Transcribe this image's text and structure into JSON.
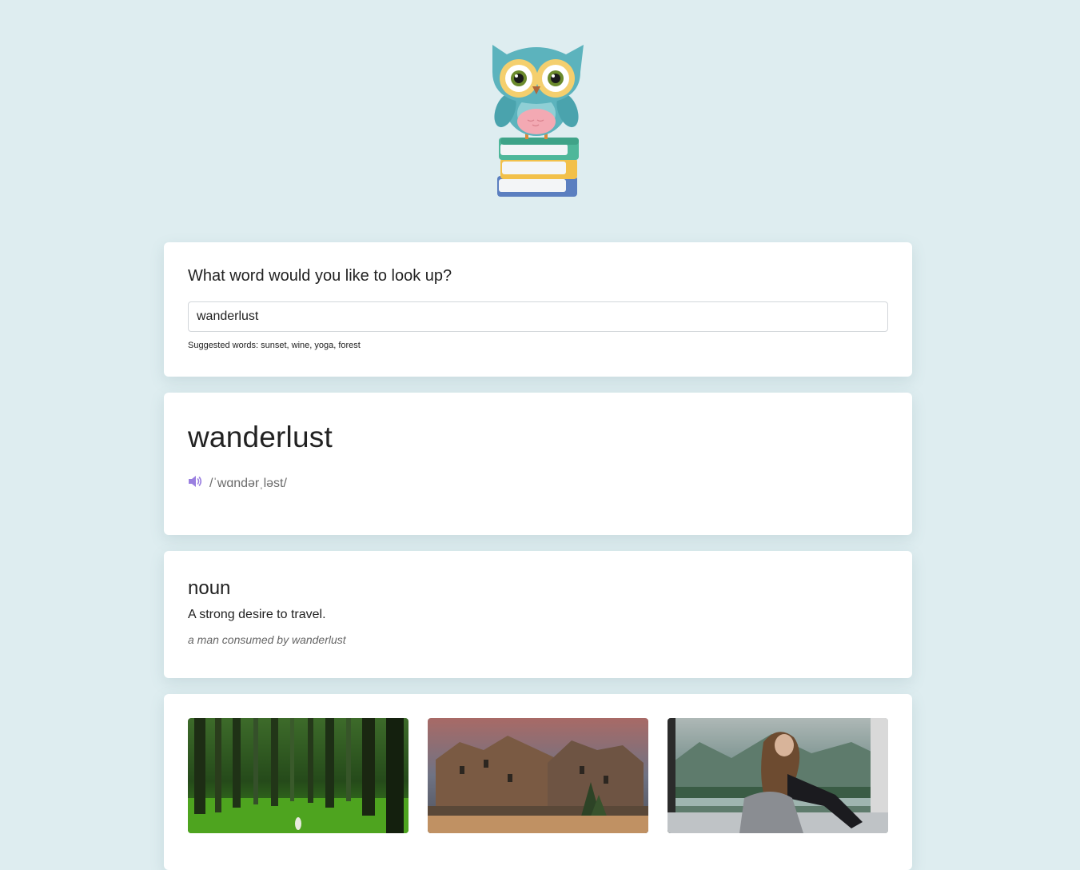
{
  "search": {
    "prompt": "What word would you like to look up?",
    "value": "wanderlust",
    "placeholder": "",
    "hint": "Suggested words: sunset, wine, yoga, forest"
  },
  "word": {
    "title": "wanderlust",
    "phonetic": "/ˈwɑndərˌləst/",
    "audio_icon": "speaker-icon"
  },
  "meaning": {
    "part_of_speech": "noun",
    "definition": "A strong desire to travel.",
    "example": "a man consumed by wanderlust"
  },
  "photos": [
    {
      "name": "forest-photo"
    },
    {
      "name": "old-town-photo"
    },
    {
      "name": "woman-at-window-photo"
    }
  ],
  "colors": {
    "background": "#deedf0",
    "card": "#ffffff",
    "accent": "#9a7fe0"
  }
}
